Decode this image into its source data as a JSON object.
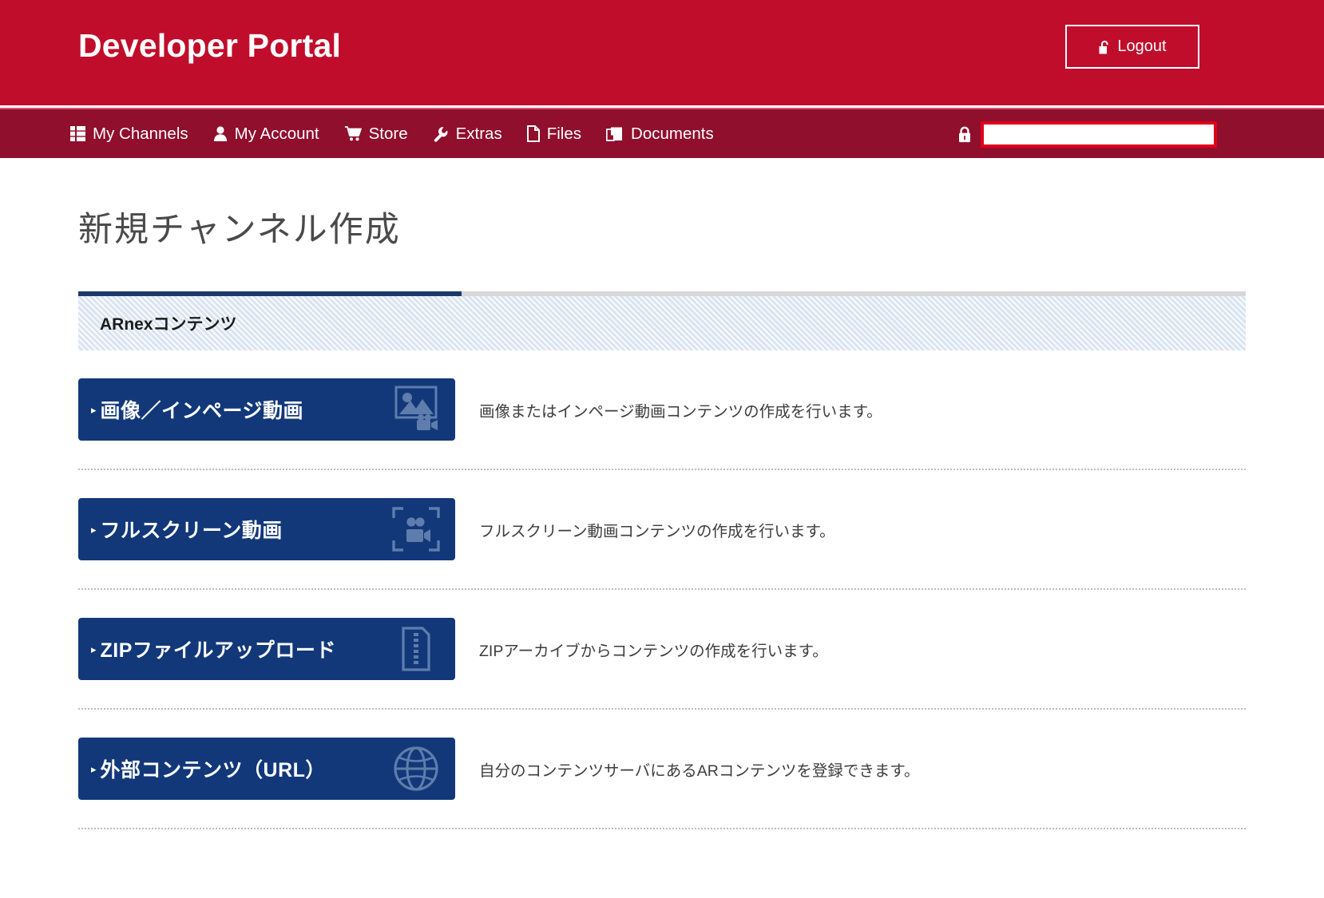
{
  "header": {
    "brand": "Developer Portal",
    "logout_label": "Logout",
    "logout_icon": "unlock-icon",
    "brand_color": "#c00d2b"
  },
  "nav": {
    "items": [
      {
        "label": "My Channels",
        "icon": "grid-list-icon"
      },
      {
        "label": "My Account",
        "icon": "user-icon"
      },
      {
        "label": "Store",
        "icon": "shopping-cart-icon"
      },
      {
        "label": "Extras",
        "icon": "wrench-icon"
      },
      {
        "label": "Files",
        "icon": "file-icon"
      },
      {
        "label": "Documents",
        "icon": "documents-stack-icon"
      }
    ],
    "lock_icon": "lock-icon",
    "search_value": "",
    "search_placeholder": "",
    "bar_color": "#8f0f2c",
    "search_border_color": "#e1001a"
  },
  "main": {
    "page_title": "新規チャンネル作成",
    "section": {
      "label": "ARnexコンテンツ",
      "accent_color": "#1b3a6b"
    },
    "options": [
      {
        "label": "画像／インページ動画",
        "description": "画像またはインページ動画コンテンツの作成を行います。",
        "icon": "image-video-icon",
        "caret": "▸"
      },
      {
        "label": "フルスクリーン動画",
        "description": "フルスクリーン動画コンテンツの作成を行います。",
        "icon": "fullscreen-video-icon",
        "caret": "▸"
      },
      {
        "label": "ZIPファイルアップロード",
        "description": "ZIPアーカイブからコンテンツの作成を行います。",
        "icon": "zip-file-icon",
        "caret": "▸"
      },
      {
        "label": "外部コンテンツ（URL）",
        "description": "自分のコンテンツサーバにあるARコンテンツを登録できます。",
        "icon": "globe-icon",
        "caret": "▸"
      }
    ],
    "button_color": "#12387a"
  }
}
